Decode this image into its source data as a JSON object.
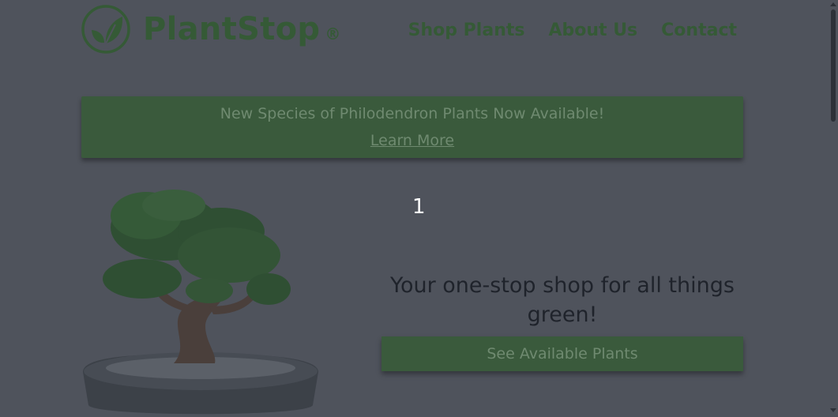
{
  "header": {
    "brand": "PlantStop",
    "registered": "®",
    "nav": [
      "Shop Plants",
      "About Us",
      "Contact"
    ]
  },
  "banner": {
    "title": "New Species of Philodendron Plants Now Available!",
    "link": "Learn More"
  },
  "carousel": {
    "slide_number": "1"
  },
  "hero": {
    "tagline": "Your one-stop shop for all things green!",
    "cta": "See Available Plants"
  },
  "colors": {
    "overlay_bg": "#4f535c",
    "brand_green": "#355a36",
    "banner_green": "#3a5a3c"
  },
  "icons": {
    "logo": "leaf-logo-icon",
    "hero_image": "bonsai-tree-illustration"
  }
}
